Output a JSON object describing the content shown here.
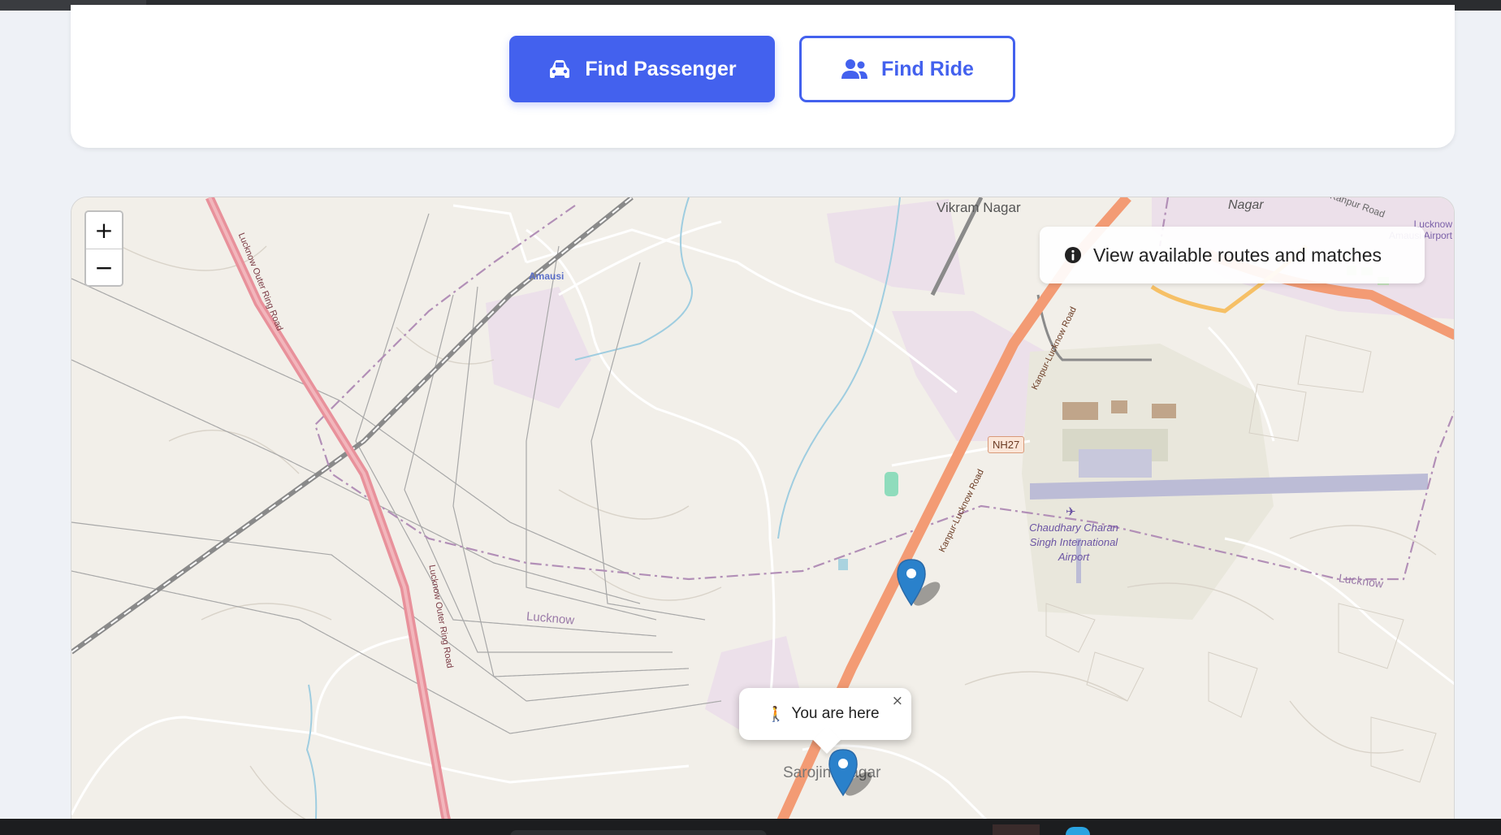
{
  "actions": {
    "find_passenger_label": "Find Passenger",
    "find_ride_label": "Find Ride",
    "find_passenger_icon": "car-icon",
    "find_ride_icon": "users-icon"
  },
  "map": {
    "zoom_in_label": "+",
    "zoom_out_label": "−",
    "info_text": "View available routes and matches",
    "info_icon": "info-circle-icon",
    "popup_text": "You are here",
    "popup_icon": "person-walking-icon",
    "popup_close": "×",
    "labels": {
      "vikram_nagar": "Vikram Nagar",
      "nagar": "Nagar",
      "kanpur_road": "Kanpur Road",
      "lucknow_amausi_airport": "Lucknow Amausi Airport",
      "amausi": "Amausi",
      "ring_road_1": "Lucknow Outer Ring Road",
      "ring_road_2": "Lucknow Outer Ring Road",
      "kanpur_lucknow_1": "Kanpur-Lucknow Road",
      "kanpur_lucknow_2": "Kanpur-Lucknow Road",
      "nh27": "NH27",
      "airport": "Chaudhary Charan Singh International Airport",
      "lucknow_left": "Lucknow",
      "lucknow_right": "Lucknow",
      "sarojini_nagar": "Sarojini Nagar"
    },
    "colors": {
      "land": "#f2efe9",
      "ring_road": "#e8919b",
      "highway": "#f39b74",
      "residential": "#ece0ea",
      "airport_area": "#e9e7dc",
      "runway": "#bcbcd6",
      "boundary": "#b28fb7",
      "marker": "#2a81cb"
    }
  }
}
